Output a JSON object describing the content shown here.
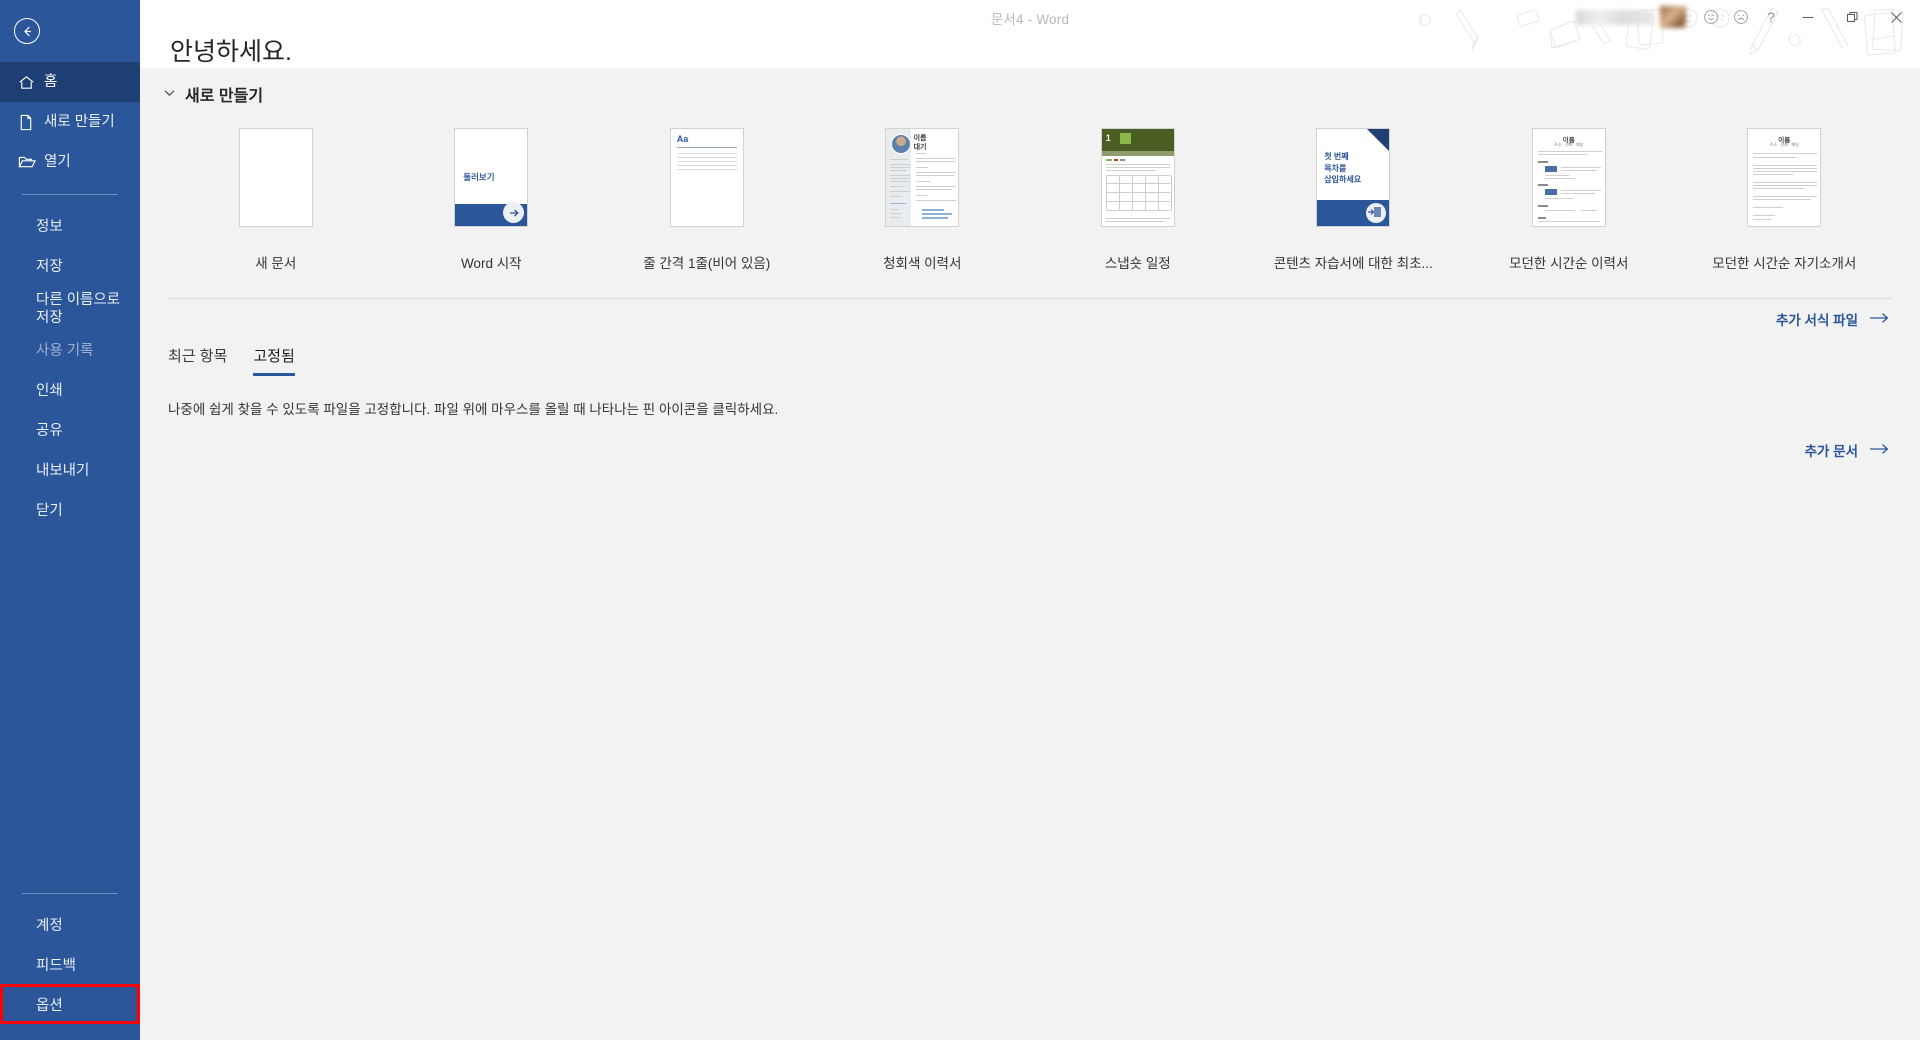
{
  "window": {
    "title": "문서4  -  Word",
    "controls": {
      "minimize": "—",
      "restore": "❐",
      "close": "✕"
    },
    "icons": {
      "smile": "smiley-face-icon",
      "frown": "frowning-face-icon",
      "help": "?",
      "user_name_blurred": "",
      "avatar_blurred": ""
    }
  },
  "sidebar": {
    "back_label": "←",
    "top_items": [
      {
        "label": "홈",
        "icon": "home-icon",
        "active": true
      },
      {
        "label": "새로 만들기",
        "icon": "new-document-icon",
        "active": false
      },
      {
        "label": "열기",
        "icon": "open-folder-icon",
        "active": false
      }
    ],
    "mid_items": [
      {
        "label": "정보",
        "disabled": false
      },
      {
        "label": "저장",
        "disabled": false
      },
      {
        "label": "다른 이름으로 저장",
        "disabled": false
      },
      {
        "label": "사용 기록",
        "disabled": true
      },
      {
        "label": "인쇄",
        "disabled": false
      },
      {
        "label": "공유",
        "disabled": false
      },
      {
        "label": "내보내기",
        "disabled": false
      },
      {
        "label": "닫기",
        "disabled": false
      }
    ],
    "bottom_items": [
      {
        "label": "계정",
        "highlighted": false
      },
      {
        "label": "피드백",
        "highlighted": false
      },
      {
        "label": "옵션",
        "highlighted": true
      }
    ],
    "highlight_color": "#ff0000",
    "background_color": "#2b579a",
    "active_color": "#1e3f73"
  },
  "main": {
    "greeting": "안녕하세요.",
    "new_section": {
      "title": "새로 만들기",
      "chevron": "⌄",
      "templates": [
        {
          "label": "새 문서",
          "kind": "blank"
        },
        {
          "label": "Word 시작",
          "kind": "tour",
          "inner_text": "둘러보기"
        },
        {
          "label": "줄 간격 1줄(비어 있음)",
          "kind": "single-spaced",
          "inner_text": "Aa"
        },
        {
          "label": "청회색 이력서",
          "kind": "resume-bluegray",
          "inner_text": "이름\n대기"
        },
        {
          "label": "스냅숏 일정",
          "kind": "calendar-snapshot",
          "inner_text": "1"
        },
        {
          "label": "콘텐츠 자습서에 대한 최초...",
          "kind": "toc-tutorial",
          "inner_text": "첫 번째\n목차를\n삽입하세요"
        },
        {
          "label": "모던한 시간순 이력서",
          "kind": "modern-resume",
          "inner_text": "이름"
        },
        {
          "label": "모던한 시간순 자기소개서",
          "kind": "modern-cover",
          "inner_text": "이름"
        }
      ],
      "more_templates_link": "추가 서식 파일",
      "more_templates_arrow": "→"
    },
    "documents_section": {
      "tabs": [
        {
          "label": "최근 항목",
          "active": false
        },
        {
          "label": "고정됨",
          "active": true
        }
      ],
      "empty_message": "나중에 쉽게 찾을 수 있도록 파일을 고정합니다. 파일 위에 마우스를 올릴 때 나타나는 핀 아이콘을 클릭하세요.",
      "more_documents_link": "추가 문서",
      "more_documents_arrow": "→"
    }
  },
  "colors": {
    "brand": "#2b579a",
    "page_bg": "#f2f2f2",
    "titlebar_bg": "#ffffff",
    "link": "#2b579a",
    "highlight": "#ff0000"
  }
}
